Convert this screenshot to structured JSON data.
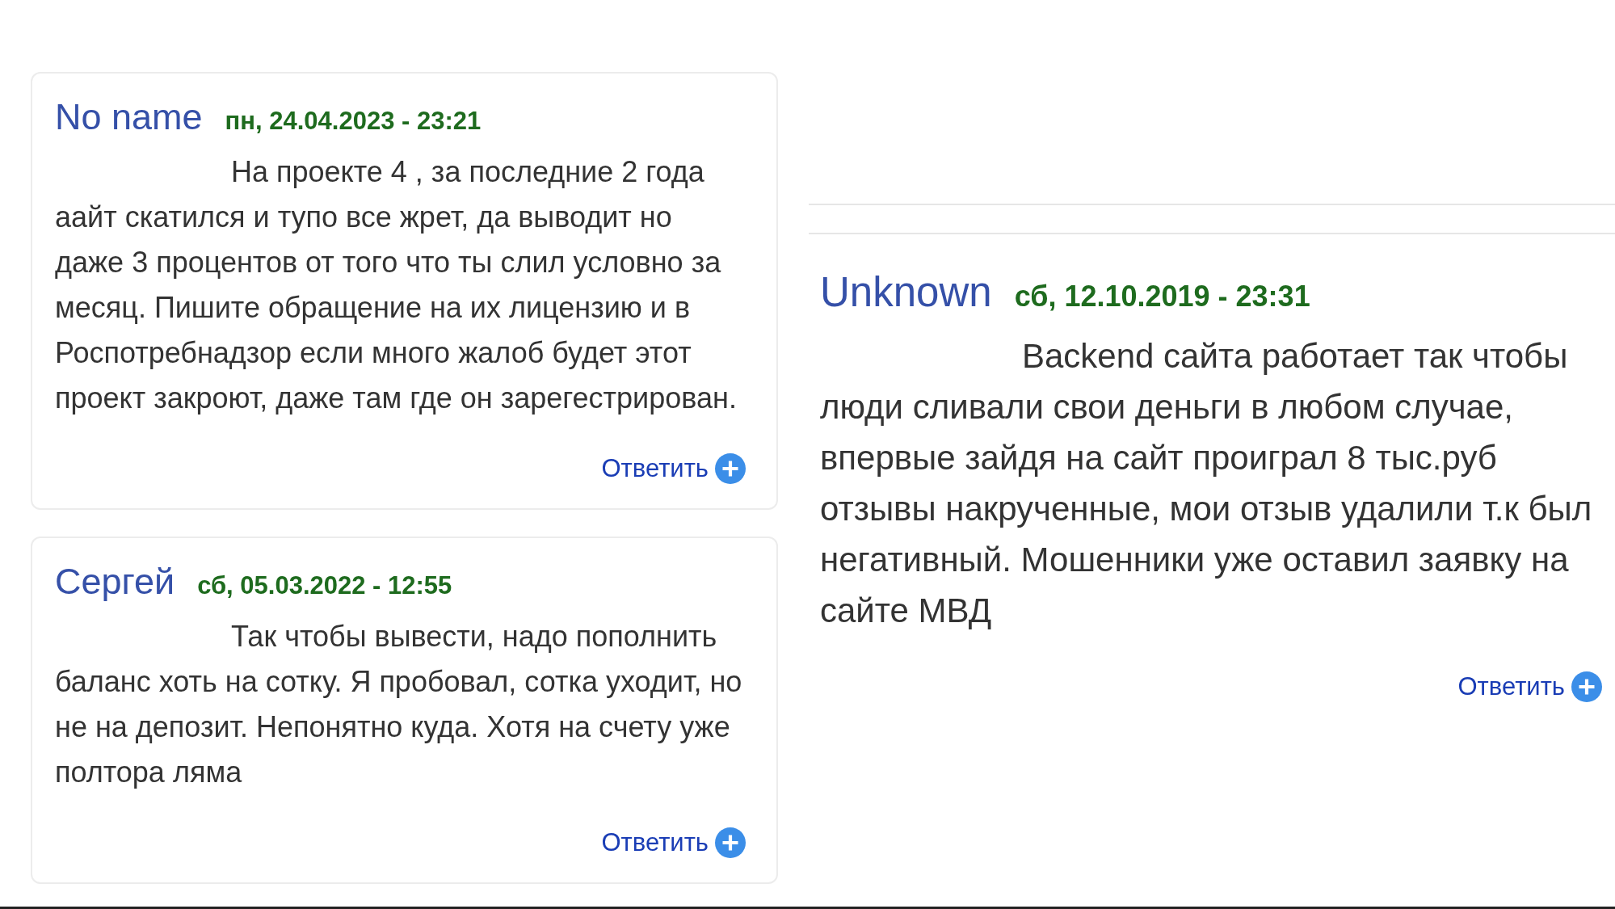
{
  "left_comments": [
    {
      "author": "No name",
      "date": "пн, 24.04.2023 - 23:21",
      "text": "На проекте 4 , за последние 2 года аайт скатился и тупо все жрет, да выводит но даже 3 процентов от того что ты слил условно за месяц. Пишите обращение на их лицензию и в Роспотребнадзор если много жалоб будет этот проект закроют, даже там где он зарегестрирован.",
      "reply": "Ответить"
    },
    {
      "author": "Сергей",
      "date": "сб, 05.03.2022 - 12:55",
      "text": "Так чтобы вывести, надо пополнить баланс хоть на сотку. Я пробовал, сотка уходит, но не на депозит. Непонятно куда. Хотя на счету уже полтора ляма",
      "reply": "Ответить"
    }
  ],
  "right_comments": [
    {
      "author": "Unknown",
      "date": "сб, 12.10.2019 - 23:31",
      "text": "Backend сайта работает так чтобы люди сливали свои деньги в любом случае, впервые зайдя на сайт проиграл 8 тыс.руб отзывы накрученные, мои отзыв удалили т.к был негативный. Мошенники уже оставил заявку на сайте МВД",
      "reply": "Ответить"
    }
  ]
}
